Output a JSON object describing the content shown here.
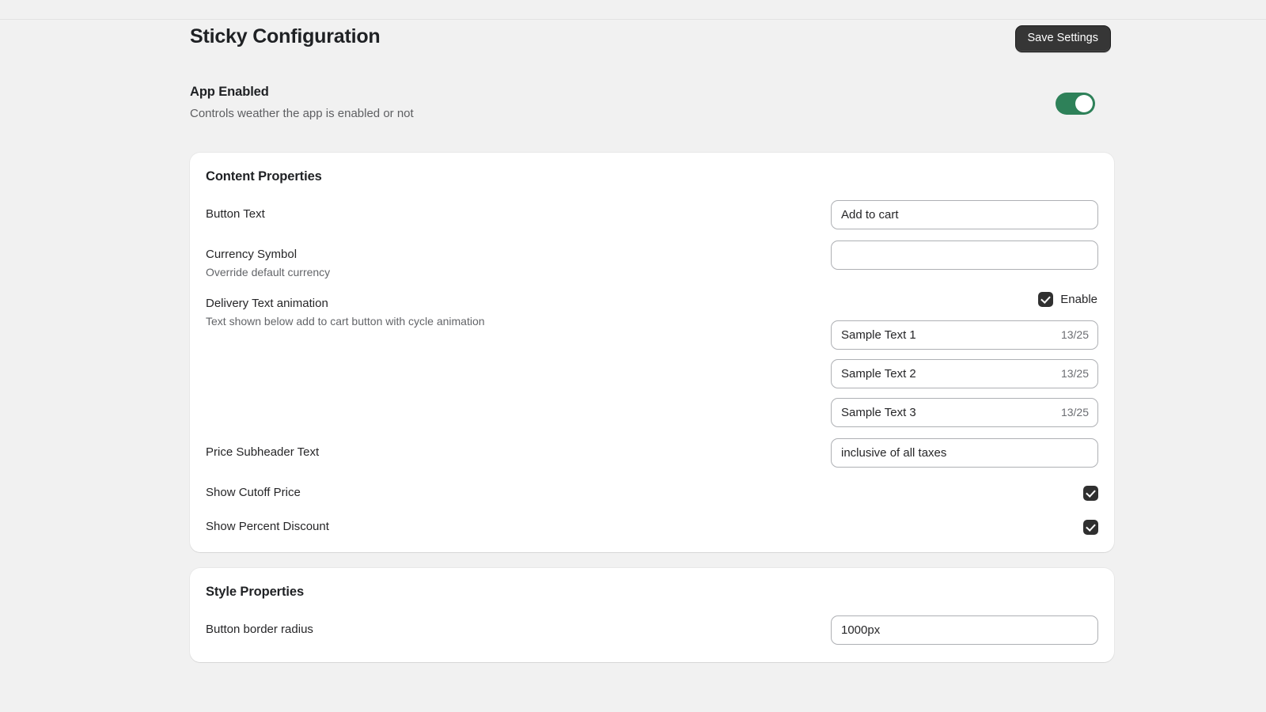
{
  "header": {
    "title": "Sticky Configuration",
    "save_label": "Save Settings"
  },
  "app_enabled": {
    "title": "App Enabled",
    "description": "Controls weather the app is enabled or not",
    "toggle_state": "on",
    "toggle_color": "#2e8159"
  },
  "content_properties": {
    "title": "Content Properties",
    "button_text": {
      "label": "Button Text",
      "value": "Add to cart"
    },
    "currency_symbol": {
      "label": "Currency Symbol",
      "help": "Override default currency",
      "value": "",
      "placeholder": ""
    },
    "delivery_text_animation": {
      "label": "Delivery Text animation",
      "help": "Text shown below add to cart button with cycle animation",
      "enable_label": "Enable",
      "enabled": true,
      "fields": [
        {
          "value": "Sample Text 1",
          "counter": "13/25"
        },
        {
          "value": "Sample Text 2",
          "counter": "13/25"
        },
        {
          "value": "Sample Text 3",
          "counter": "13/25"
        }
      ]
    },
    "price_subheader": {
      "label": "Price Subheader Text",
      "value": "inclusive of all taxes"
    },
    "show_cutoff_price": {
      "label": "Show Cutoff Price",
      "checked": true
    },
    "show_percent_discount": {
      "label": "Show Percent Discount",
      "checked": true
    }
  },
  "style_properties": {
    "title": "Style Properties",
    "button_border_radius": {
      "label": "Button border radius",
      "value": "1000px"
    }
  },
  "colors": {
    "page_background": "#f1f1f1",
    "card_background": "#ffffff",
    "accent_dark": "#303030",
    "toggle_green": "#2e8159"
  }
}
